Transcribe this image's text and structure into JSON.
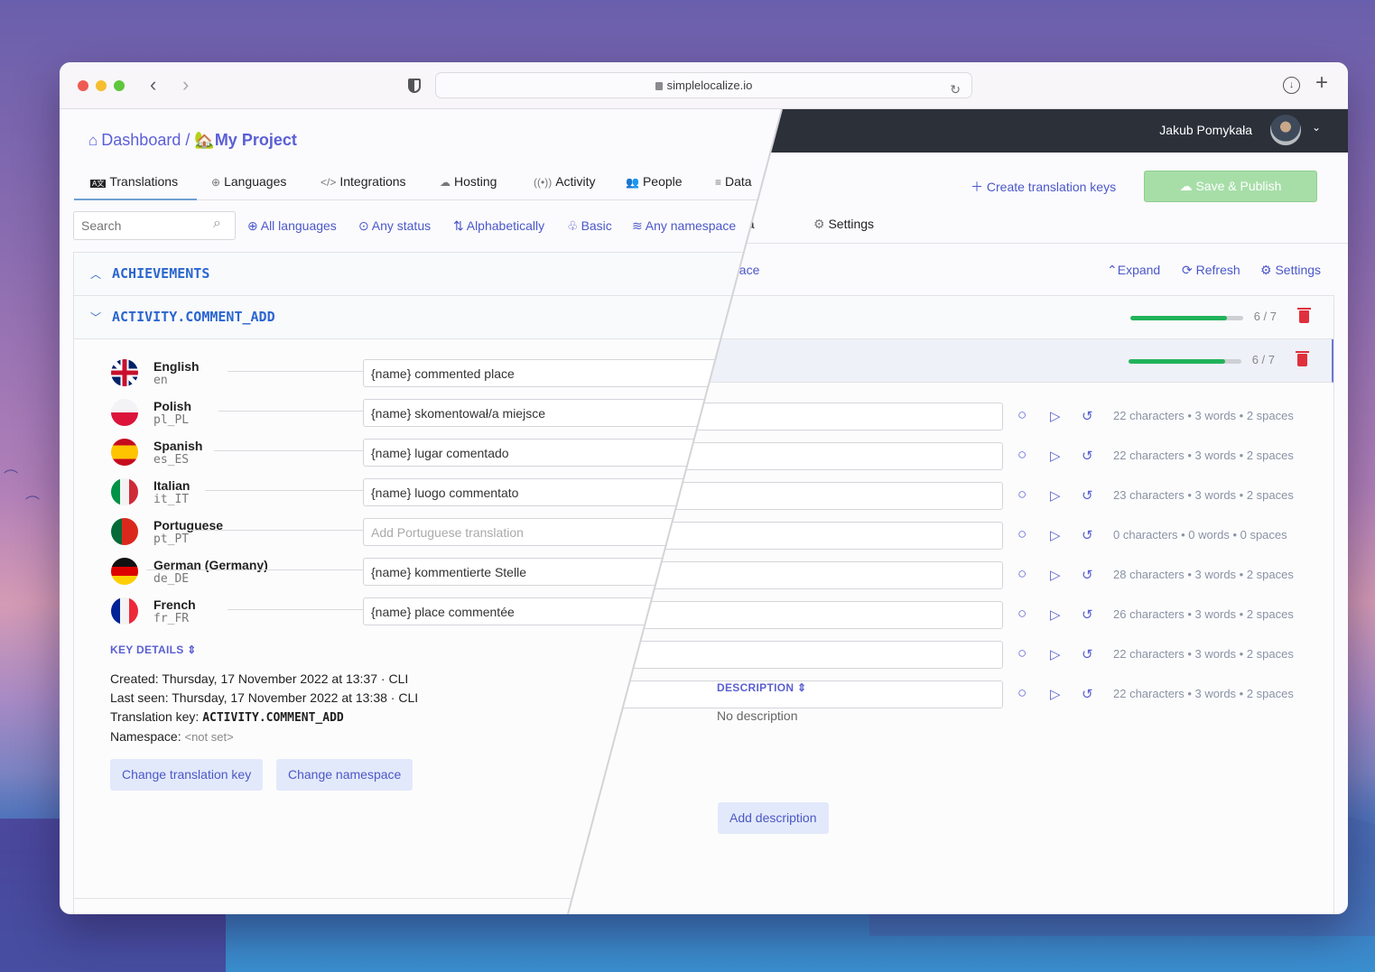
{
  "browser": {
    "url": "simplelocalize.io",
    "back_icon": "chevron-left-icon",
    "forward_icon": "chevron-right-icon"
  },
  "user": {
    "name": "Jakub Pomykała"
  },
  "breadcrumb": {
    "dashboard": "Dashboard",
    "separator": "/",
    "project_emoji": "🏡",
    "project": "My Project"
  },
  "tabs": [
    {
      "icon": "🆎",
      "label": "Translations",
      "active": true
    },
    {
      "icon": "⊕",
      "label": "Languages"
    },
    {
      "icon": "</>",
      "label": "Integrations"
    },
    {
      "icon": "☁",
      "label": "Hosting"
    },
    {
      "icon": "((•))",
      "label": "Activity"
    },
    {
      "icon": "👥",
      "label": "People"
    },
    {
      "icon": "≡",
      "label": "Data"
    },
    {
      "icon": "⚙",
      "label": "Settings"
    }
  ],
  "toolbar": {
    "create_keys": "Create translation keys",
    "save_publish": "Save & Publish"
  },
  "filters": {
    "search_placeholder": "Search",
    "all_languages": "All languages",
    "any_status": "Any status",
    "alphabetically": "Alphabetically",
    "basic": "Basic",
    "any_namespace": "Any namespace",
    "namespace_partial": "space"
  },
  "view_actions": {
    "expand": "Expand",
    "refresh": "Refresh",
    "settings": "Settings"
  },
  "groups": [
    {
      "name": "ACHIEVEMENTS",
      "expanded": false,
      "progress_text": "6 / 7",
      "progress": 0.857
    },
    {
      "name": "ACTIVITY.COMMENT_ADD",
      "expanded": true,
      "progress_text": "6 / 7",
      "progress": 0.857
    }
  ],
  "languages": [
    {
      "name": "English",
      "code": "en",
      "value": "{name} commented place",
      "placeholder": "",
      "stats": "22 characters • 3 words • 2 spaces"
    },
    {
      "name": "Polish",
      "code": "pl_PL",
      "value": "{name} skomentował/a miejsce",
      "placeholder": "",
      "stats": "22 characters • 3 words • 2 spaces"
    },
    {
      "name": "Spanish",
      "code": "es_ES",
      "value": "{name} lugar comentado",
      "placeholder": "",
      "stats": "23 characters • 3 words • 2 spaces"
    },
    {
      "name": "Italian",
      "code": "it_IT",
      "value": "{name} luogo commentato",
      "placeholder": "",
      "stats": "0 characters • 0 words • 0 spaces"
    },
    {
      "name": "Portuguese",
      "code": "pt_PT",
      "value": "",
      "placeholder": "Add Portuguese translation",
      "stats": "28 characters • 3 words • 2 spaces"
    },
    {
      "name": "German (Germany)",
      "code": "de_DE",
      "value": "{name} kommentierte Stelle",
      "placeholder": "",
      "stats": "26 characters • 3 words • 2 spaces"
    },
    {
      "name": "French",
      "code": "fr_FR",
      "value": "{name} place commentée",
      "placeholder": "",
      "stats": "22 characters • 3 words • 2 spaces"
    }
  ],
  "key_details": {
    "title": "KEY DETAILS",
    "created_label": "Created:",
    "created": "Thursday, 17 November 2022 at 13:37",
    "created_source": "CLI",
    "last_seen_label": "Last seen:",
    "last_seen": "Thursday, 17 November 2022 at 13:38",
    "last_seen_source": "CLI",
    "key_label": "Translation key:",
    "key": "ACTIVITY.COMMENT_ADD",
    "namespace_label": "Namespace:",
    "namespace": "<not set>",
    "change_key": "Change translation key",
    "change_namespace": "Change namespace"
  },
  "description": {
    "title": "DESCRIPTION",
    "text": "No description",
    "add": "Add description"
  },
  "colors": {
    "accent": "#4b58c9",
    "key_blue": "#2b66d0",
    "progress": "#21b35a",
    "delete": "#e0303e",
    "save_button": "#a7dea8",
    "header_dark": "#2b3039"
  }
}
